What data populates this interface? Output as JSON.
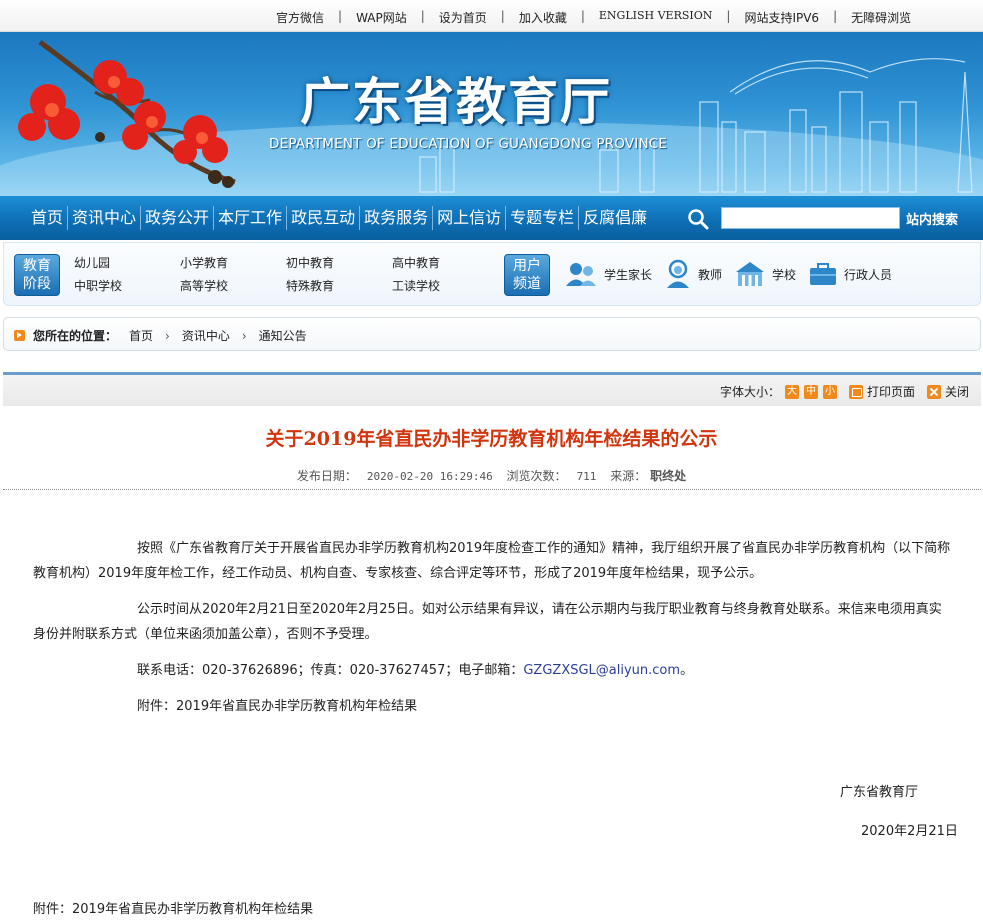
{
  "topbar": {
    "links": [
      "官方微信",
      "WAP网站",
      "设为首页",
      "加入收藏",
      "ENGLISH VERSION",
      "网站支持IPV6",
      "无障碍浏览"
    ],
    "separator": "|"
  },
  "banner": {
    "title": "广东省教育厅",
    "subtitle": "DEPARTMENT OF EDUCATION OF GUANGDONG PROVINCE"
  },
  "nav": {
    "items": [
      "首页",
      "资讯中心",
      "政务公开",
      "本厅工作",
      "政民互动",
      "政务服务",
      "网上信访",
      "专题专栏",
      "反腐倡廉"
    ],
    "search_placeholder": "",
    "search_button": "站内搜索"
  },
  "channels": {
    "stage_badge": [
      "教育",
      "阶段"
    ],
    "stages": [
      "幼儿园",
      "小学教育",
      "初中教育",
      "高中教育",
      "中职学校",
      "高等学校",
      "特殊教育",
      "工读学校"
    ],
    "user_badge": [
      "用户",
      "频道"
    ],
    "users": [
      "学生家长",
      "教师",
      "学校",
      "行政人员"
    ]
  },
  "breadcrumb": {
    "label": "您所在的位置：",
    "items": [
      "首页",
      "资讯中心",
      "通知公告"
    ],
    "separator": "›"
  },
  "toolbar": {
    "font_size_label": "字体大小：",
    "sizes": [
      "大",
      "中",
      "小"
    ],
    "print": "打印页面",
    "close": "关闭"
  },
  "article": {
    "title": "关于2019年省直民办非学历教育机构年检结果的公示",
    "meta": {
      "date_label": "发布日期：",
      "date": "2020-02-20 16:29:46",
      "views_label": "浏览次数：",
      "views": "711",
      "source_label": "来源：",
      "source": "职终处"
    },
    "paragraphs": [
      "按照《广东省教育厅关于开展省直民办非学历教育机构2019年度检查工作的通知》精神，我厅组织开展了省直民办非学历教育机构（以下简称教育机构）2019年度年检工作，经工作动员、机构自查、专家核查、综合评定等环节，形成了2019年度年检结果，现予公示。",
      "公示时间从2020年2月21日至2020年2月25日。如对公示结果有异议，请在公示期内与我厅职业教育与终身教育处联系。来信来电须用真实身份并附联系方式（单位来函须加盖公章），否则不予受理。"
    ],
    "contact_prefix": "联系电话：020-37626896；传真：020-37627457；电子邮箱：",
    "email": "GZGZXSGL@aliyun.com",
    "contact_suffix": "。",
    "attachment_line": "附件：2019年省直民办非学历教育机构年检结果",
    "sign_org": "广东省教育厅",
    "sign_date": "2020年2月21日",
    "attachment_link": "附件：2019年省直民办非学历教育机构年检结果"
  },
  "colors": {
    "nav_blue": "#0e6fb5",
    "title_red": "#d2350d",
    "accent_orange": "#f08a1c",
    "email_blue": "#2b3f9a"
  }
}
